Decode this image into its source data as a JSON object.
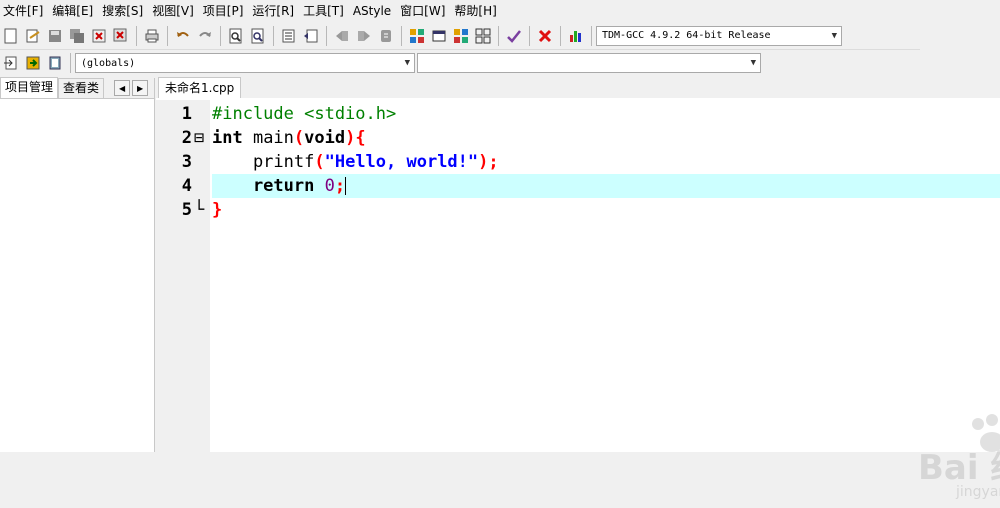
{
  "menu": [
    "文件[F]",
    "编辑[E]",
    "搜索[S]",
    "视图[V]",
    "项目[P]",
    "运行[R]",
    "工具[T]",
    "AStyle",
    "窗口[W]",
    "帮助[H]"
  ],
  "toolbar": {
    "compiler_select": "TDM-GCC 4.9.2 64-bit Release",
    "icons": [
      "new-file-icon",
      "open-file-icon",
      "save-icon",
      "save-all-icon",
      "close-file-icon",
      "close-all-icon",
      "print-icon",
      "undo-icon",
      "redo-icon",
      "find-icon",
      "replace-icon",
      "indent-icon",
      "unindent-icon",
      "goto-back-icon",
      "goto-forward-icon",
      "bookmark-icon",
      "compile-icon",
      "run-icon",
      "compile-run-icon",
      "rebuild-icon",
      "syntax-check-icon",
      "stop-icon",
      "chart-icon"
    ]
  },
  "toolbar2": {
    "globals_select": "(globals)",
    "second_select": ""
  },
  "left_panel": {
    "tabs": [
      "项目管理",
      "查看类"
    ]
  },
  "editor": {
    "file_tab": "未命名1.cpp",
    "lines": [
      {
        "num": "1",
        "tokens": [
          {
            "t": "#include <stdio.h>",
            "c": "pp"
          }
        ]
      },
      {
        "num": "2",
        "fold": "⊟",
        "tokens": [
          {
            "t": "int",
            "c": "kw"
          },
          {
            "t": " main",
            "c": ""
          },
          {
            "t": "(",
            "c": "br"
          },
          {
            "t": "void",
            "c": "kw"
          },
          {
            "t": ")",
            "c": "br"
          },
          {
            "t": "{",
            "c": "br"
          }
        ]
      },
      {
        "num": "3",
        "tokens": [
          {
            "t": "    printf",
            "c": ""
          },
          {
            "t": "(",
            "c": "br"
          },
          {
            "t": "\"Hello, world!\"",
            "c": "str"
          },
          {
            "t": ");",
            "c": "br"
          }
        ]
      },
      {
        "num": "4",
        "current": true,
        "tokens": [
          {
            "t": "    return",
            "c": "kw"
          },
          {
            "t": " ",
            "c": ""
          },
          {
            "t": "0",
            "c": "num"
          },
          {
            "t": ";",
            "c": "br"
          }
        ]
      },
      {
        "num": "5",
        "fold": "└",
        "tokens": [
          {
            "t": "}",
            "c": "br"
          }
        ]
      }
    ]
  },
  "watermark": {
    "main": "Bai  经验",
    "sub": "jingyan.baidu.com"
  }
}
